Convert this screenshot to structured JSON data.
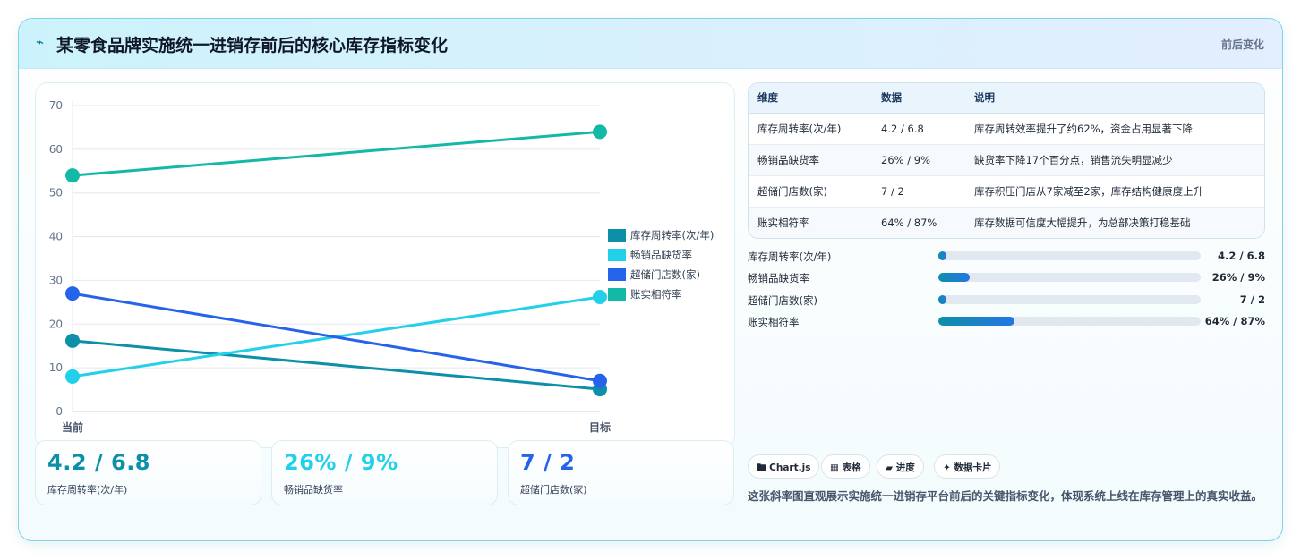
{
  "header": {
    "icon": "lightning-icon",
    "icon_glyph": "⌁",
    "title": "某零食品牌实施统一进销存前后的核心库存指标变化",
    "right_label": "前后变化"
  },
  "chart_data": {
    "type": "line",
    "categories": [
      "当前",
      "目标"
    ],
    "ylim": [
      0,
      70
    ],
    "yticks": [
      0,
      10,
      20,
      30,
      40,
      50,
      60,
      70
    ],
    "ytick_labels": [
      "0",
      "10",
      "20",
      "30",
      "40",
      "50",
      "60",
      "70"
    ],
    "grid": true,
    "legend_position": "right",
    "series": [
      {
        "name": "库存周转率(次/年)",
        "values": [
          16.2,
          5.1
        ],
        "color": "#0e8fa8"
      },
      {
        "name": "畅销品缺货率",
        "values": [
          8.0,
          26.2
        ],
        "color": "#22d0ea"
      },
      {
        "name": "超储门店数(家)",
        "values": [
          27.0,
          7.0
        ],
        "color": "#2563eb"
      },
      {
        "name": "账实相符率",
        "values": [
          54.0,
          64.0
        ],
        "color": "#14b8a6"
      }
    ]
  },
  "kpis": [
    {
      "value": "4.2 / 6.8",
      "label": "库存周转率(次/年)",
      "color": "#0e8fa8"
    },
    {
      "value": "26% / 9%",
      "label": "畅销品缺货率",
      "color": "#22d0ea"
    },
    {
      "value": "7 / 2",
      "label": "超储门店数(家)",
      "color": "#2563eb"
    }
  ],
  "table": {
    "headers": [
      "维度",
      "数据",
      "说明"
    ],
    "rows": [
      [
        "库存周转率(次/年)",
        "4.2 / 6.8",
        "库存周转效率提升了约62%，资金占用显著下降"
      ],
      [
        "畅销品缺货率",
        "26% / 9%",
        "缺货率下降17个百分点，销售流失明显减少"
      ],
      [
        "超储门店数(家)",
        "7 / 2",
        "库存积压门店从7家减至2家，库存结构健康度上升"
      ],
      [
        "账实相符率",
        "64% / 87%",
        "库存数据可信度大幅提升，为总部决策打稳基础"
      ]
    ]
  },
  "progress": [
    {
      "label": "库存周转率(次/年)",
      "value": "4.2 / 6.8",
      "fill": 0.03
    },
    {
      "label": "畅销品缺货率",
      "value": "26% / 9%",
      "fill": 0.12
    },
    {
      "label": "超储门店数(家)",
      "value": "7 / 2",
      "fill": 0.03
    },
    {
      "label": "账实相符率",
      "value": "64% / 87%",
      "fill": 0.29
    }
  ],
  "tags": [
    {
      "icon": "chart-icon",
      "label": "🖿 Chart.js"
    },
    {
      "icon": "table-icon",
      "label": "▦ 表格"
    },
    {
      "icon": "progress-icon",
      "label": "▰ 进度"
    },
    {
      "icon": "card-icon",
      "label": "✦ 数据卡片"
    }
  ],
  "description": "这张斜率图直观展示实施统一进销存平台前后的关键指标变化，体现系统上线在库存管理上的真实收益。"
}
